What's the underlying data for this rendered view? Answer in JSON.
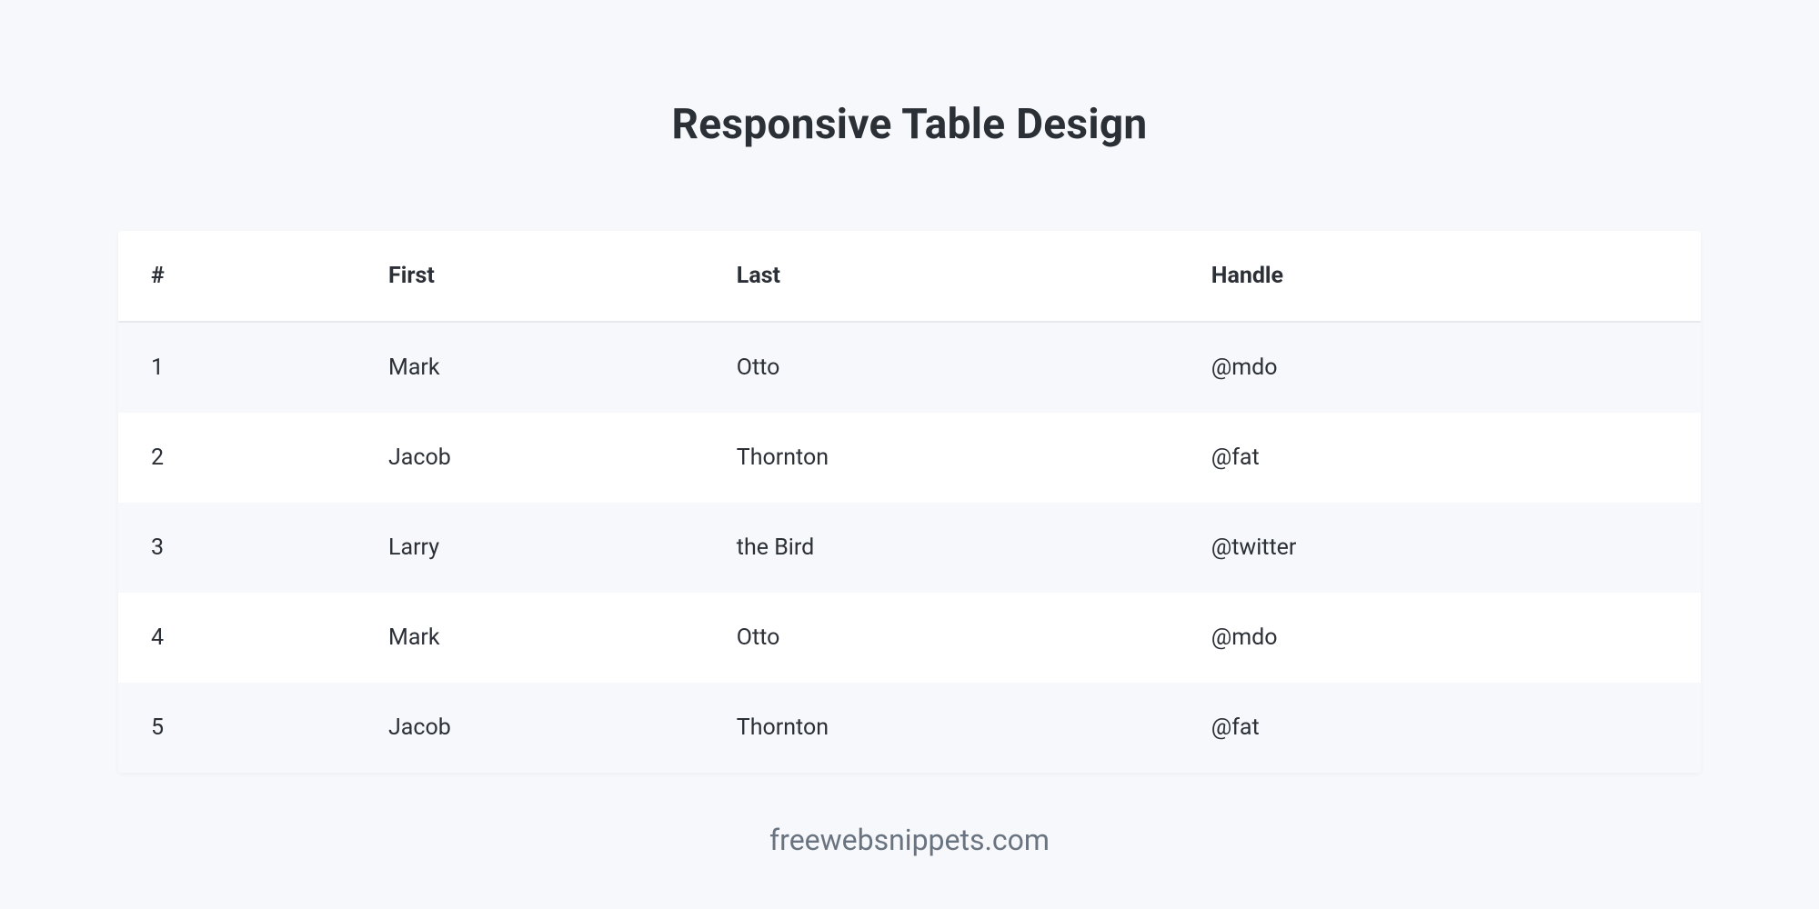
{
  "title": "Responsive Table Design",
  "columns": [
    "#",
    "First",
    "Last",
    "Handle"
  ],
  "rows": [
    {
      "id": "1",
      "first": "Mark",
      "last": "Otto",
      "handle": "@mdo"
    },
    {
      "id": "2",
      "first": "Jacob",
      "last": "Thornton",
      "handle": "@fat"
    },
    {
      "id": "3",
      "first": "Larry",
      "last": "the Bird",
      "handle": "@twitter"
    },
    {
      "id": "4",
      "first": "Mark",
      "last": "Otto",
      "handle": "@mdo"
    },
    {
      "id": "5",
      "first": "Jacob",
      "last": "Thornton",
      "handle": "@fat"
    }
  ],
  "footer": "freewebsnippets.com"
}
